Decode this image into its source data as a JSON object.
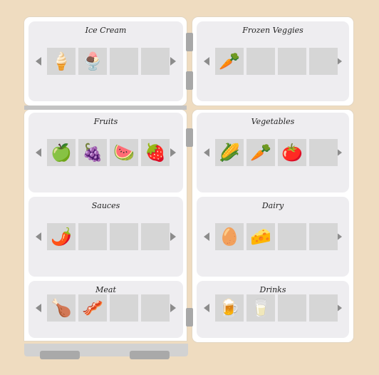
{
  "shelves": [
    {
      "id": "ice-cream",
      "label": "Ice Cream",
      "items": [
        "🍦",
        "🍨",
        "",
        ""
      ]
    },
    {
      "id": "frozen-veggies",
      "label": "Frozen Veggies",
      "items": [
        "🥕",
        "",
        "",
        ""
      ]
    },
    {
      "id": "fruits",
      "label": "Fruits",
      "items": [
        "🍏",
        "🍇",
        "🍉",
        "🍓"
      ]
    },
    {
      "id": "vegetables",
      "label": "Vegetables",
      "items": [
        "🌽",
        "🥕",
        "🍅",
        ""
      ]
    },
    {
      "id": "sauces",
      "label": "Sauces",
      "items": [
        "🌶️",
        "",
        "",
        ""
      ]
    },
    {
      "id": "dairy",
      "label": "Dairy",
      "items": [
        "🥚",
        "🧀",
        "",
        ""
      ]
    },
    {
      "id": "meat",
      "label": "Meat",
      "items": [
        "🍗",
        "🥓",
        "",
        ""
      ]
    },
    {
      "id": "drinks",
      "label": "Drinks",
      "items": [
        "🍺",
        "🥛",
        "",
        ""
      ]
    }
  ],
  "item_names": {
    "🍦": "soft-serve-icon",
    "🍨": "ice-cream-bowl-icon",
    "🥕": "carrot-icon",
    "🍏": "green-apple-icon",
    "🍇": "grapes-icon",
    "🍉": "watermelon-icon",
    "🍓": "strawberry-icon",
    "🌽": "corn-icon",
    "🍅": "tomato-icon",
    "🌶️": "chili-pepper-icon",
    "🥚": "egg-icon",
    "🧀": "cheese-icon",
    "🍗": "drumstick-icon",
    "🥓": "bacon-icon",
    "🍺": "beer-mug-icon",
    "🥛": "milk-glass-icon"
  },
  "colors": {
    "background": "#efdcc0",
    "door": "#ffffff",
    "shelf": "#eeedf0",
    "slot": "#d6d6d6",
    "arrow": "#8c8c8c"
  }
}
